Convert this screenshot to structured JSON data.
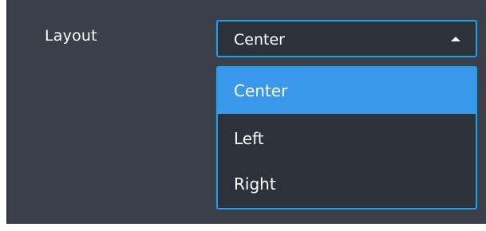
{
  "layout_field": {
    "label": "Layout",
    "selected_value": "Center",
    "options": [
      "Center",
      "Left",
      "Right"
    ]
  },
  "colors": {
    "panel_background": "#3b3f4a",
    "control_background": "#2d313a",
    "focus_border": "#1ea1e6",
    "selected_option": "#3a98ea",
    "text": "#ffffff"
  },
  "icons": {
    "dropdown_caret": "caret-up-icon"
  }
}
